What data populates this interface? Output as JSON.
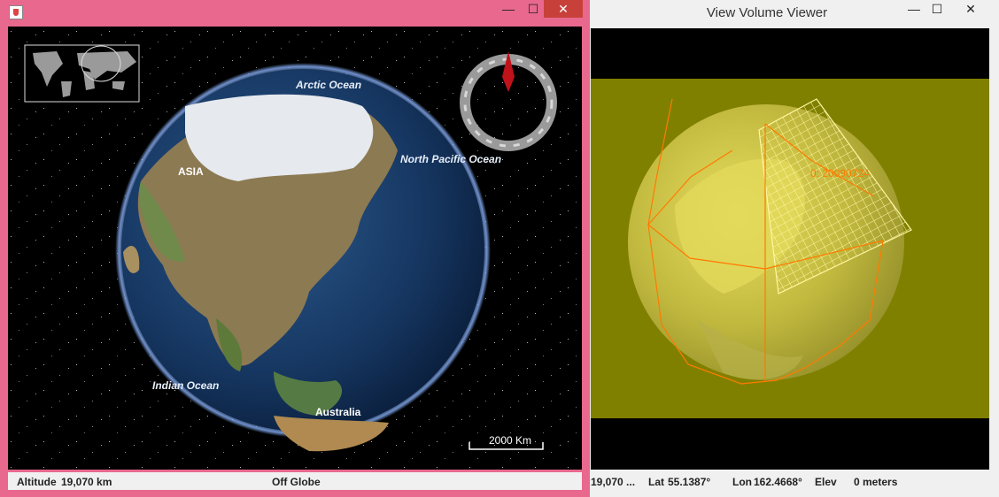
{
  "left_window": {
    "title_icon": "java-cup-icon",
    "controls": {
      "minimize": "—",
      "maximize": "☐",
      "close": "✕"
    },
    "map_labels": {
      "arctic": "Arctic Ocean",
      "north_pacific": "North Pacific Ocean",
      "asia": "ASIA",
      "indian": "Indian Ocean",
      "australia": "Australia"
    },
    "scale_bar": "2000 Km",
    "status": {
      "altitude_label": "Altitude",
      "altitude_value": "19,070 km",
      "globe_status": "Off Globe"
    }
  },
  "right_window": {
    "title": "View Volume Viewer",
    "controls": {
      "minimize": "—",
      "maximize": "☐",
      "close": "✕"
    },
    "overlay_label": "0: 20090724",
    "status": {
      "altitude": "19,070 ...",
      "lat_label": "Lat",
      "lat_value": "55.1387°",
      "lon_label": "Lon",
      "lon_value": "162.4668°",
      "elev_label": "Elev",
      "elev_value": "0 meters"
    }
  },
  "colors": {
    "left_frame": "#e8688e",
    "close_button": "#c7413a",
    "volume_fill": "#808000",
    "frustum": "#ff7a00"
  }
}
